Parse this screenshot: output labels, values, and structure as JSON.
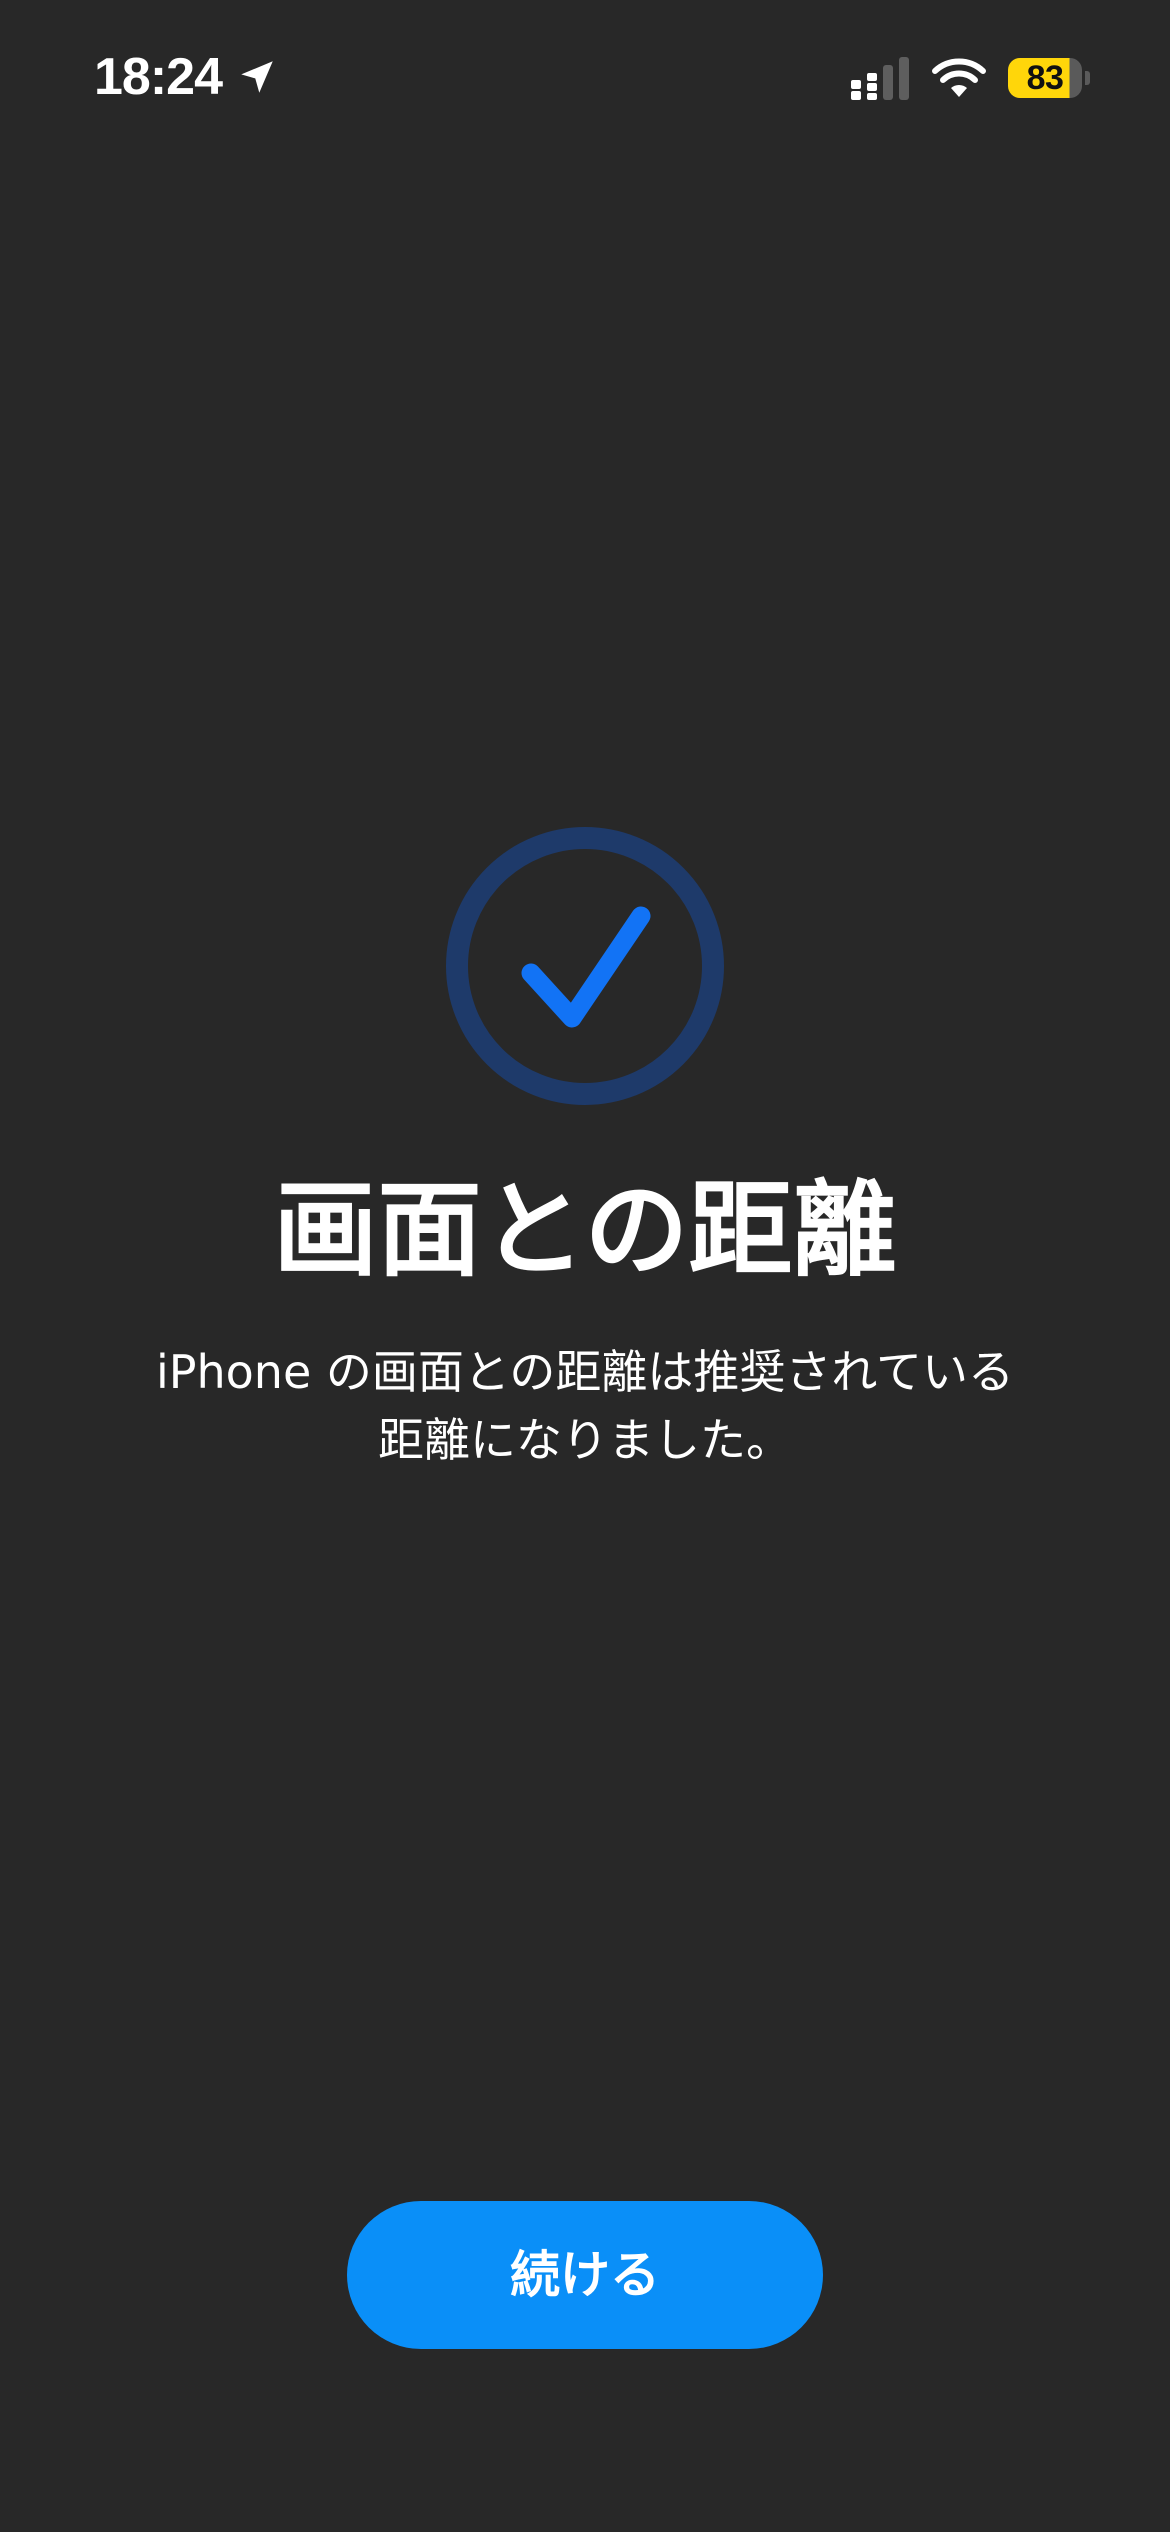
{
  "status_bar": {
    "time": "18:24",
    "location_icon": "location-arrow-icon",
    "signal_icon": "cellular-signal-icon",
    "wifi_icon": "wifi-icon",
    "battery_level": "83",
    "battery_color": "#ffd60a"
  },
  "main": {
    "status_icon": "checkmark-circle-icon",
    "title": "画面との距離",
    "description_line1": "iPhone の画面との距離は推奨されている",
    "description_line2": "距離になりました。"
  },
  "actions": {
    "continue_label": "続ける"
  },
  "colors": {
    "background": "#282828",
    "accent": "#0a8ff8",
    "check": "#1273f5",
    "ring": "#1e3a6a"
  }
}
